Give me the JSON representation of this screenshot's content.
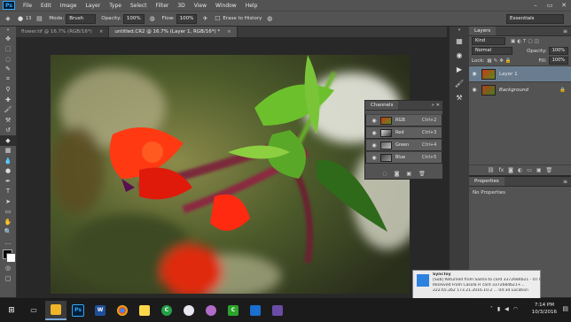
{
  "app": {
    "logo_text": "Ps"
  },
  "menu": [
    "File",
    "Edit",
    "Image",
    "Layer",
    "Type",
    "Select",
    "Filter",
    "3D",
    "View",
    "Window",
    "Help"
  ],
  "window_controls": {
    "minimize": "–",
    "maximize": "▭",
    "close": "✕"
  },
  "options_bar": {
    "brush_size": "13",
    "mode_label": "Mode:",
    "mode_value": "Brush",
    "opacity_label": "Opacity:",
    "opacity_value": "100%",
    "flow_label": "Flow:",
    "flow_value": "100%",
    "erase_history_label": "Erase to History",
    "workspace": "Essentials"
  },
  "tabs": [
    {
      "label": "flower.tif @ 16.7% (RGB/16*)",
      "close": "×"
    },
    {
      "label": "untitled.CR2 @ 16.7% (Layer 1, RGB/16*) *",
      "close": "×"
    }
  ],
  "layers_panel": {
    "title": "Layers",
    "kind_label": "Kind",
    "blend_mode": "Normal",
    "opacity_label": "Opacity:",
    "opacity_value": "100%",
    "lock_label": "Lock:",
    "fill_label": "Fill:",
    "fill_value": "100%",
    "layers": [
      {
        "name": "Layer 1",
        "active": true
      },
      {
        "name": "Background",
        "active": false
      }
    ],
    "footer_icons": [
      "link-icon",
      "fx-icon",
      "mask-icon",
      "adjustment-icon",
      "group-icon",
      "new-layer-icon",
      "trash-icon"
    ],
    "footer_glyphs": [
      "⛓",
      "fx",
      "◙",
      "◐",
      "▭",
      "▣",
      "🗑"
    ]
  },
  "properties_panel": {
    "title": "Properties",
    "empty_text": "No Properties"
  },
  "channels_panel": {
    "title": "Channels",
    "channels": [
      {
        "name": "RGB",
        "shortcut": "Ctrl+2"
      },
      {
        "name": "Red",
        "shortcut": "Ctrl+3"
      },
      {
        "name": "Green",
        "shortcut": "Ctrl+4"
      },
      {
        "name": "Blue",
        "shortcut": "Ctrl+5"
      }
    ]
  },
  "notification": {
    "title": "SyncToy",
    "lines": [
      "[Sub] Returned from Sasha to card 3372684b21 - OTT",
      "Received From Casola H card 3372684b21+...",
      "222.65.2b2 173.21.2016.10.2 ... 04:34 Location"
    ]
  },
  "taskbar": {
    "time": "7:14 PM",
    "date": "10/3/2016"
  }
}
